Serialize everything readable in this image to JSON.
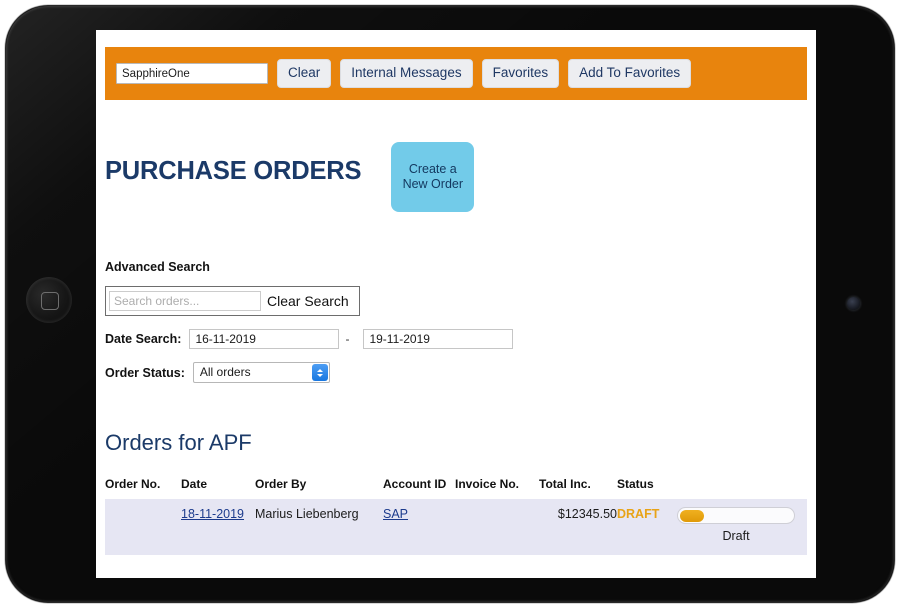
{
  "toolbar": {
    "search_value": "SapphireOne",
    "search_placeholder": "",
    "buttons": [
      {
        "label": "Clear"
      },
      {
        "label": "Internal Messages"
      },
      {
        "label": "Favorites"
      },
      {
        "label": "Add To Favorites"
      }
    ]
  },
  "header": {
    "page_title": "PURCHASE ORDERS",
    "new_order_line1": "Create a",
    "new_order_line2": "New Order"
  },
  "advanced_search": {
    "section_label": "Advanced Search",
    "search_value": "",
    "search_placeholder": "Search orders...",
    "clear_search_label": "Clear Search",
    "date_label": "Date Search:",
    "date_from": "16-11-2019",
    "date_to": "19-11-2019",
    "date_separator": "-",
    "status_label": "Order Status:",
    "status_value": "All orders",
    "status_options": [
      "All orders"
    ]
  },
  "orders": {
    "heading": "Orders for APF",
    "columns": [
      "Order No.",
      "Date",
      "Order By",
      "Account ID",
      "Invoice No.",
      "Total Inc.",
      "Status"
    ],
    "rows": [
      {
        "order_no": "",
        "date": "18-11-2019",
        "order_by": "Marius Liebenberg",
        "account_id": "SAP",
        "invoice_no": "",
        "total_inc": "$12345.50",
        "status": "DRAFT",
        "toggle_label": "Draft"
      }
    ]
  },
  "colors": {
    "toolbar_orange": "#e8840d",
    "title_navy": "#1b3a68",
    "new_order_blue": "#72cbe9",
    "row_lavender": "#e6e6f3",
    "status_orange": "#e8a317",
    "link_blue": "#1b3a8c"
  }
}
